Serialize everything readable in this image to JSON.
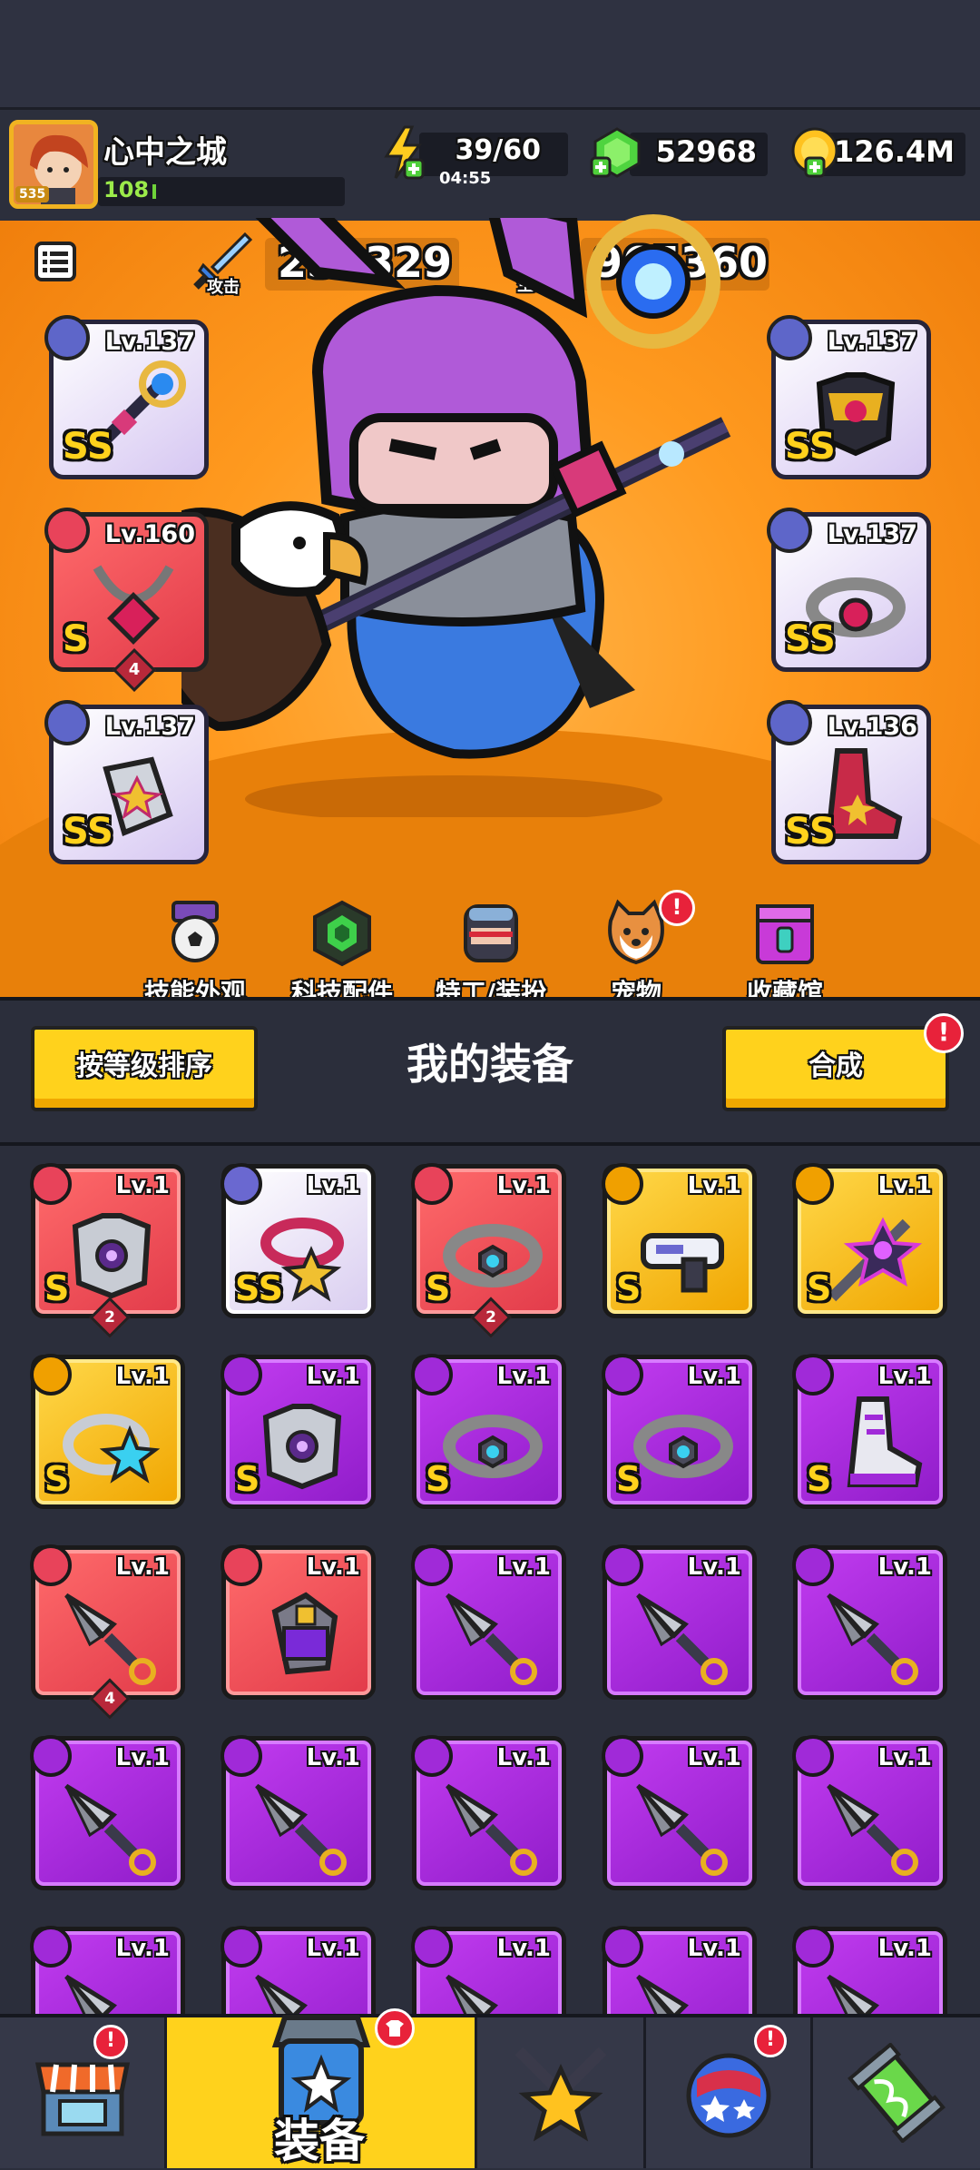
{
  "player": {
    "name": "心中之城",
    "avatar_level": "535",
    "level": "108"
  },
  "resources": {
    "energy": "39/60",
    "energy_timer": "04:55",
    "gems": "52968",
    "coins": "126.4M"
  },
  "stats": {
    "attack_label": "攻击",
    "attack_value": "250329",
    "hp_label": "生命",
    "hp_value": "965360"
  },
  "equipped": {
    "weapon": {
      "level": "Lv.137",
      "rank": "SS"
    },
    "necklace": {
      "level": "Lv.160",
      "rank": "S",
      "stars": "4"
    },
    "gloves": {
      "level": "Lv.137",
      "rank": "SS"
    },
    "armor": {
      "level": "Lv.137",
      "rank": "SS"
    },
    "belt": {
      "level": "Lv.137",
      "rank": "SS"
    },
    "boots": {
      "level": "Lv.136",
      "rank": "SS"
    }
  },
  "features": [
    {
      "label": "技能外观"
    },
    {
      "label": "科技配件"
    },
    {
      "label": "特工/装扮"
    },
    {
      "label": "宠物"
    },
    {
      "label": "收藏馆"
    }
  ],
  "inventory": {
    "sort_label": "按等级排序",
    "title": "我的装备",
    "merge_label": "合成",
    "badge": "!",
    "items": [
      {
        "level": "Lv.1",
        "rank": "S",
        "stars": "2",
        "color": "red",
        "icon": "armor-icon"
      },
      {
        "level": "Lv.1",
        "rank": "SS",
        "stars": "",
        "color": "white",
        "icon": "necklace-icon"
      },
      {
        "level": "Lv.1",
        "rank": "S",
        "stars": "2",
        "color": "red",
        "icon": "belt-icon"
      },
      {
        "level": "Lv.1",
        "rank": "S",
        "stars": "",
        "color": "yellow",
        "icon": "gun-icon"
      },
      {
        "level": "Lv.1",
        "rank": "S",
        "stars": "",
        "color": "yellow",
        "icon": "staff-icon"
      },
      {
        "level": "Lv.1",
        "rank": "S",
        "stars": "",
        "color": "yellow",
        "icon": "ring-icon"
      },
      {
        "level": "Lv.1",
        "rank": "S",
        "stars": "",
        "color": "purple",
        "icon": "armor-icon"
      },
      {
        "level": "Lv.1",
        "rank": "S",
        "stars": "",
        "color": "purple",
        "icon": "belt-icon"
      },
      {
        "level": "Lv.1",
        "rank": "S",
        "stars": "",
        "color": "purple",
        "icon": "belt-icon"
      },
      {
        "level": "Lv.1",
        "rank": "S",
        "stars": "",
        "color": "purple",
        "icon": "boots-icon"
      },
      {
        "level": "Lv.1",
        "rank": "",
        "stars": "4",
        "color": "red",
        "icon": "kunai-icon"
      },
      {
        "level": "Lv.1",
        "rank": "",
        "stars": "",
        "color": "red",
        "icon": "glove-icon"
      },
      {
        "level": "Lv.1",
        "rank": "",
        "stars": "",
        "color": "purple",
        "icon": "kunai-icon"
      },
      {
        "level": "Lv.1",
        "rank": "",
        "stars": "",
        "color": "purple",
        "icon": "kunai-icon"
      },
      {
        "level": "Lv.1",
        "rank": "",
        "stars": "",
        "color": "purple",
        "icon": "kunai-icon"
      },
      {
        "level": "Lv.1",
        "rank": "",
        "stars": "",
        "color": "purple",
        "icon": "kunai-icon"
      },
      {
        "level": "Lv.1",
        "rank": "",
        "stars": "",
        "color": "purple",
        "icon": "kunai-icon"
      },
      {
        "level": "Lv.1",
        "rank": "",
        "stars": "",
        "color": "purple",
        "icon": "kunai-icon"
      },
      {
        "level": "Lv.1",
        "rank": "",
        "stars": "",
        "color": "purple",
        "icon": "kunai-icon"
      },
      {
        "level": "Lv.1",
        "rank": "",
        "stars": "",
        "color": "purple",
        "icon": "kunai-icon"
      },
      {
        "level": "Lv.1",
        "rank": "",
        "stars": "",
        "color": "purple",
        "icon": "kunai-icon"
      },
      {
        "level": "Lv.1",
        "rank": "",
        "stars": "",
        "color": "purple",
        "icon": "kunai-icon"
      },
      {
        "level": "Lv.1",
        "rank": "",
        "stars": "",
        "color": "purple",
        "icon": "kunai-icon"
      },
      {
        "level": "Lv.1",
        "rank": "",
        "stars": "",
        "color": "purple",
        "icon": "kunai-icon"
      },
      {
        "level": "Lv.1",
        "rank": "",
        "stars": "",
        "color": "purple",
        "icon": "kunai-icon"
      }
    ]
  },
  "bottom_nav": {
    "active_label": "装备",
    "items": [
      "shop-icon",
      "equipment-icon",
      "arena-icon",
      "adventure-icon",
      "evolve-icon"
    ]
  },
  "colors": {
    "accent": "#ffd21c",
    "stage": "#ff9a1f",
    "alert": "#e8223a"
  }
}
